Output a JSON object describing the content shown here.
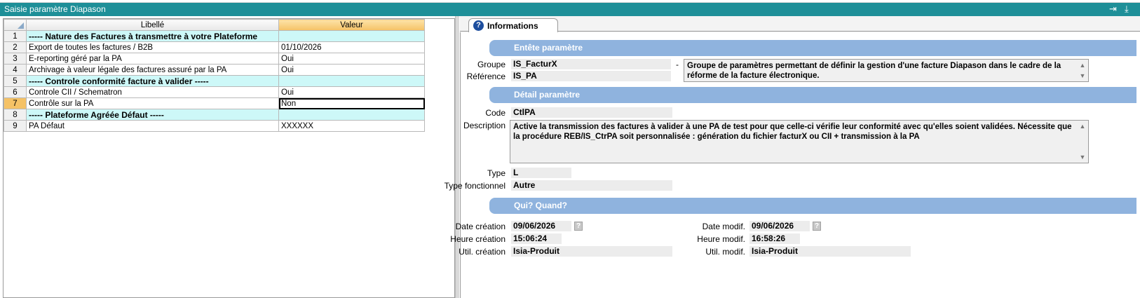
{
  "window": {
    "title": "Saisie paramètre Diapason",
    "pin_icon": "pin-right-icon",
    "download_icon": "download-icon"
  },
  "grid": {
    "columns": [
      "Libellé",
      "Valeur"
    ],
    "rows": [
      {
        "n": "1",
        "libelle": "----- Nature des Factures à transmettre à votre Plateforme",
        "valeur": "",
        "section": true
      },
      {
        "n": "2",
        "libelle": "Export de toutes les factures / B2B",
        "valeur": "01/10/2026",
        "section": false
      },
      {
        "n": "3",
        "libelle": "E-reporting géré par la PA",
        "valeur": "Oui",
        "section": false
      },
      {
        "n": "4",
        "libelle": "Archivage à valeur légale des factures assuré par la PA",
        "valeur": "Oui",
        "section": false
      },
      {
        "n": "5",
        "libelle": "----- Controle conformité facture à valider -----",
        "valeur": "",
        "section": true
      },
      {
        "n": "6",
        "libelle": "Controle CII / Schematron",
        "valeur": "Oui",
        "section": false
      },
      {
        "n": "7",
        "libelle": "Contrôle sur la PA",
        "valeur": "Non",
        "section": false,
        "selected": true
      },
      {
        "n": "8",
        "libelle": "----- Plateforme Agréée Défaut -----",
        "valeur": "",
        "section": true
      },
      {
        "n": "9",
        "libelle": "PA Défaut",
        "valeur": "XXXXXX",
        "section": false
      }
    ]
  },
  "info": {
    "tab_label": "Informations",
    "entete": {
      "header": "Entête paramètre",
      "groupe_label": "Groupe",
      "groupe": "IS_FacturX",
      "reference_label": "Référence",
      "reference": "IS_PA",
      "dash": "-",
      "description": "Groupe de paramètres permettant de définir la gestion d'une facture Diapason dans le cadre de la réforme de la facture électronique."
    },
    "detail": {
      "header": "Détail paramètre",
      "code_label": "Code",
      "code": "CtlPA",
      "description_label": "Description",
      "description": "Active la transmission des factures à valider à une PA de test pour que celle-ci vérifie leur conformité avec qu'elles soient validées. Nécessite que la procédure REB/IS_CtrPA soit personnalisée : génération du fichier facturX ou CII + transmission à la PA",
      "type_label": "Type",
      "type": "L",
      "type_fonctionnel_label": "Type fonctionnel",
      "type_fonctionnel": "Autre"
    },
    "qui": {
      "header": "Qui? Quand?",
      "date_creation_label": "Date création",
      "date_creation": "09/06/2026",
      "heure_creation_label": "Heure création",
      "heure_creation": "15:06:24",
      "util_creation_label": "Util. création",
      "util_creation": "Isia-Produit",
      "date_modif_label": "Date modif.",
      "date_modif": "09/06/2026",
      "heure_modif_label": "Heure modif.",
      "heure_modif": "16:58:26",
      "util_modif_label": "Util. modif.",
      "util_modif": "Isia-Produit",
      "help_glyph": "?"
    }
  }
}
